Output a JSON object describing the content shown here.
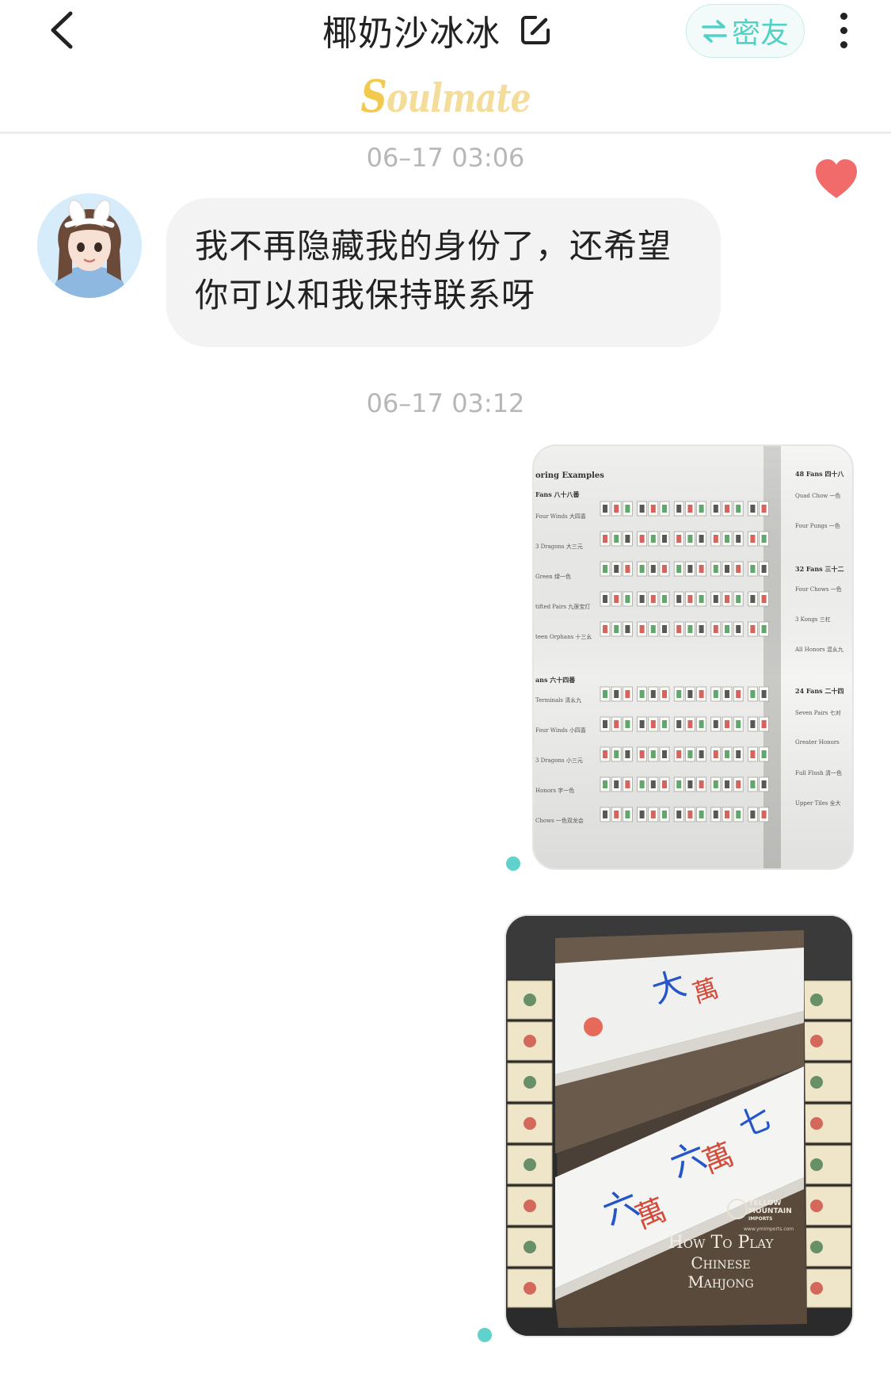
{
  "header": {
    "title": "椰奶沙冰冰",
    "mode_label": "密友",
    "relation_badge": {
      "first": "S",
      "rest": "oulmate"
    }
  },
  "messages": {
    "time_1": "06–17 03:06",
    "incoming_text": "我不再隐藏我的身份了，还希望你可以和我保持联系呀",
    "time_2": "06–17 03:12"
  },
  "photo1": {
    "heading": "oring Examples",
    "left_sections": [
      {
        "title": "Fans 八十八番",
        "rows": [
          "Four Winds 大四喜",
          "3 Dragons 大三元",
          "Green 绿一色",
          "tifted Pairs 九莲宝灯",
          "teen Orphans 十三幺"
        ]
      },
      {
        "title": "ans 六十四番",
        "rows": [
          "Terminals 清幺九",
          "Four Winds 小四喜",
          "3 Dragons 小三元",
          "Honors 字一色",
          "Chows 一色双龙会"
        ]
      }
    ],
    "right_sections": [
      {
        "title": "48 Fans 四十八",
        "rows": [
          "Quad Chow 一色",
          "Four Pungs 一色"
        ]
      },
      {
        "title": "32 Fans 三十二",
        "rows": [
          "Four Chows 一色",
          "3 Kongs 三杠",
          "All Honors 混幺九"
        ]
      },
      {
        "title": "24 Fans 二十四",
        "rows": [
          "Seven Pairs 七对",
          "Greater Honors",
          "Full Flush 清一色",
          "Upper Tiles 全大"
        ]
      }
    ]
  },
  "photo2": {
    "brand_line1": "YELLOW",
    "brand_line2": "MOUNTAIN",
    "brand_line3": "IMPORTS",
    "brand_url": "www.ymimports.com",
    "book_line1": "How To Play",
    "book_line2": "Chinese",
    "book_line3": "Mahjong"
  },
  "colors": {
    "accent": "#5fd3cb",
    "heart": "#f26b6b",
    "bubble": "#f3f3f3",
    "badge": "#f3c94d"
  },
  "icons": [
    "back-arrow-icon",
    "edit-icon",
    "swap-arrows-icon",
    "more-vertical-icon",
    "heart-icon"
  ]
}
